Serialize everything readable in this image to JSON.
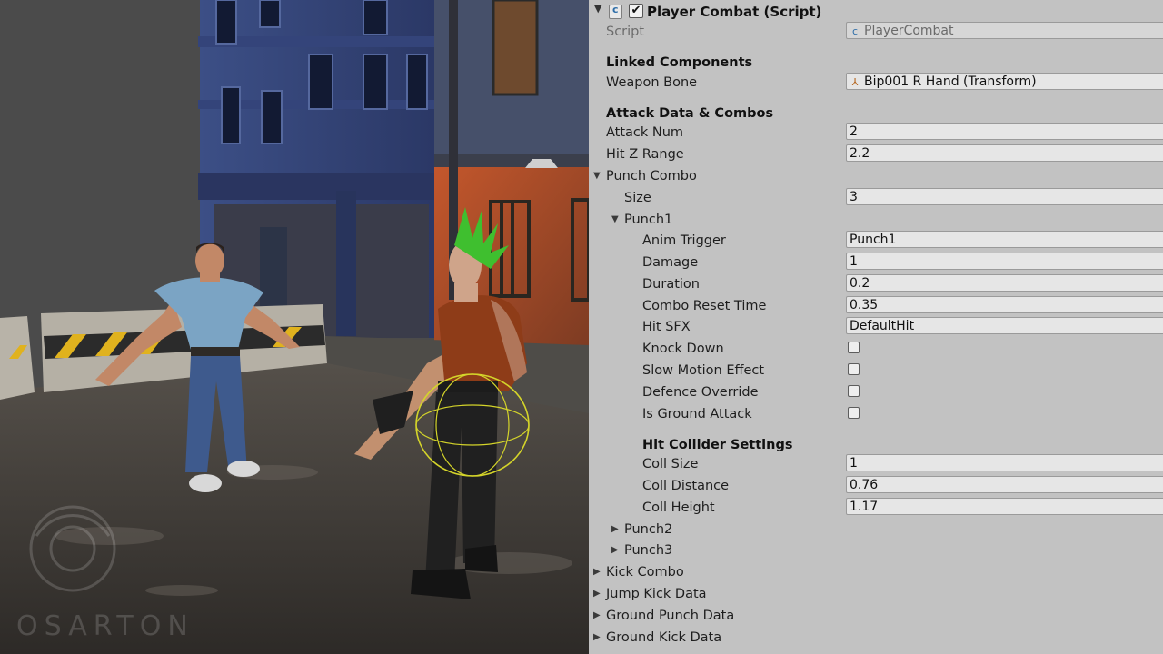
{
  "component": {
    "title": "Player Combat (Script)",
    "fold_icon": "▼",
    "enabled_check": "✔",
    "script_label": "Script",
    "script_value": "PlayerCombat"
  },
  "sections": {
    "linked": "Linked Components",
    "attack": "Attack Data & Combos",
    "hit_collider": "Hit Collider Settings"
  },
  "fields": {
    "weapon_bone_label": "Weapon Bone",
    "weapon_bone_value": "Bip001 R Hand (Transform)",
    "attack_num_label": "Attack Num",
    "attack_num_value": "2",
    "hit_z_label": "Hit Z Range",
    "hit_z_value": "2.2",
    "punch_combo_label": "Punch Combo",
    "size_label": "Size",
    "size_value": "3",
    "punch1_label": "Punch1",
    "anim_trigger_label": "Anim Trigger",
    "anim_trigger_value": "Punch1",
    "damage_label": "Damage",
    "damage_value": "1",
    "duration_label": "Duration",
    "duration_value": "0.2",
    "combo_reset_label": "Combo Reset Time",
    "combo_reset_value": "0.35",
    "hit_sfx_label": "Hit SFX",
    "hit_sfx_value": "DefaultHit",
    "knock_down_label": "Knock Down",
    "slow_motion_label": "Slow Motion Effect",
    "defence_override_label": "Defence Override",
    "is_ground_label": "Is Ground Attack",
    "coll_size_label": "Coll Size",
    "coll_size_value": "1",
    "coll_distance_label": "Coll Distance",
    "coll_distance_value": "0.76",
    "coll_height_label": "Coll Height",
    "coll_height_value": "1.17",
    "punch2_label": "Punch2",
    "punch3_label": "Punch3",
    "kick_combo_label": "Kick Combo",
    "jump_kick_label": "Jump Kick Data",
    "ground_punch_label": "Ground Punch Data",
    "ground_kick_label": "Ground Kick Data"
  },
  "checkboxes": {
    "knock_down": false,
    "slow_motion": false,
    "defence_override": false,
    "is_ground_attack": false
  },
  "arrows": {
    "expanded": "▼",
    "collapsed": "▶"
  },
  "watermark": "OSARTON",
  "icons": {
    "script": "script-icon",
    "transform": "transform-icon"
  },
  "colors": {
    "inspector_bg": "#c2c2c2",
    "field_bg": "#e6e6e6",
    "mohawk": "#3fbf2f",
    "gizmo": "#d4d42a"
  }
}
